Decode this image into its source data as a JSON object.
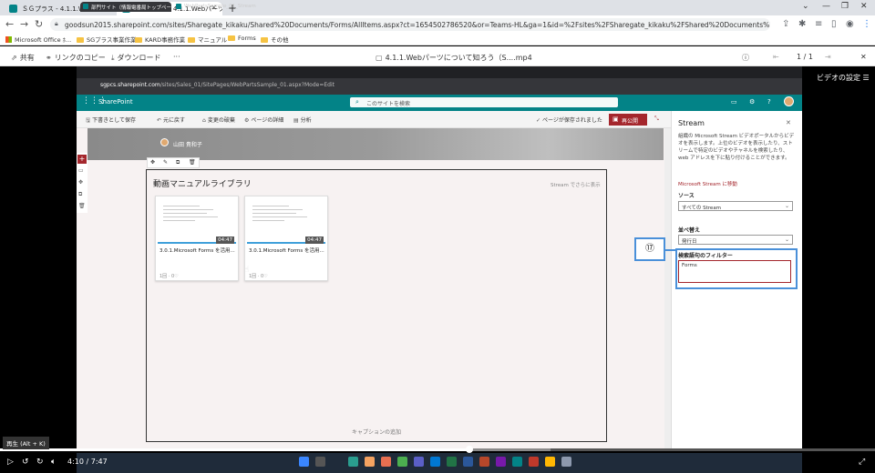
{
  "browser": {
    "tabs": [
      {
        "label": "ＳＧプラス - 4.1.1.Webパーツについ",
        "active": false
      },
      {
        "label": "ＳＧプラス - 4.1.1.Webパーツについ",
        "active": true
      }
    ],
    "new_tab": "+",
    "url": "goodsun2015.sharepoint.com/sites/Sharegate_kikaku/Shared%20Documents/Forms/AllItems.aspx?ct=1654502786520&or=Teams-HL&ga=1&id=%2Fsites%2FSharegate_kikaku%2FShared%20Documents%2F3%2Eサービス資料%2F30%2EMS%20NAVI...",
    "bookmarks": [
      "Microsoft Office ﾎ...",
      "SGプラス事業作業",
      "KARD事務作業",
      "マニュアル",
      "Forms",
      "その他"
    ]
  },
  "viewer": {
    "share": "共有",
    "copy_link": "リンクのコピー",
    "download": "ダウンロード",
    "more": "···",
    "file_title": "4.1.1.Webパーツについて知ろう（S....mp4",
    "page_current": "1",
    "page_total": "1",
    "video_settings": "ビデオの設定"
  },
  "inner_browser": {
    "tabs": [
      "部門サイト（情報電番局トップペー",
      "WebPartsSample_01_Stream"
    ],
    "url_host": "sgpcs.sharepoint.com",
    "url_path": "/sites/Sales_01/SitePages/WebPartsSample_01.aspx?Mode=Edit"
  },
  "sharepoint": {
    "brand": "SharePoint",
    "search_placeholder": "このサイトを検索",
    "cmd": {
      "save_draft": "下書きとして保存",
      "undo": "元に戻す",
      "discard": "変更の破棄",
      "page_details": "ページの詳細",
      "analytics": "分析",
      "saved_status": "ページが保存されました",
      "republish": "再公開"
    },
    "author": "山田 貴和子",
    "library_title": "動画マニュアルライブラリ",
    "stream_link": "Stream でさらに表示",
    "videos": [
      {
        "title": "3.0.1.Microsoft Forms を活用...",
        "duration": "04:47",
        "meta": "1回 · 0♡"
      },
      {
        "title": "3.0.1.Microsoft Forms を活用...",
        "duration": "04:47",
        "meta": "1回 · 0♡"
      }
    ],
    "caption_add": "キャプションの追加"
  },
  "stream_pane": {
    "title": "Stream",
    "description": "組織の Microsoft Stream ビデオポータルからビデオを表示します。上位のビデオを表示したり、ストリームで特定のビデオやチャネルを検索したり、web アドレスを下に貼り付けることができます。",
    "goto_link": "Microsoft Stream に移動",
    "source_label": "ソース",
    "source_value": "すべての Stream",
    "sort_label": "並べ替え",
    "sort_value": "発行日",
    "filter_label": "検索語句のフィルター",
    "filter_value": "Forms",
    "step_marker": "⑰"
  },
  "player": {
    "tooltip": "再生 (Alt + K)",
    "time_current": "4:10",
    "time_total": "7:47",
    "progress": 0.536
  },
  "colors": {
    "sp_teal": "#038387",
    "republish_red": "#a4262c",
    "highlight_blue": "#4a90d9"
  }
}
